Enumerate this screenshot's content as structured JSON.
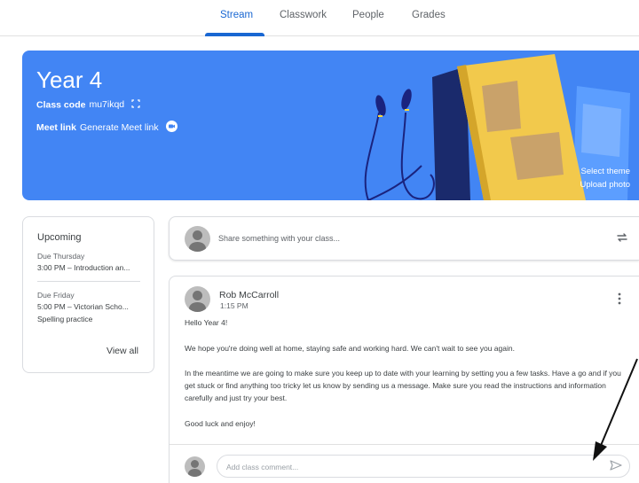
{
  "tabs": [
    {
      "label": "Stream"
    },
    {
      "label": "Classwork"
    },
    {
      "label": "People"
    },
    {
      "label": "Grades"
    }
  ],
  "banner": {
    "title": "Year 4",
    "class_code_label": "Class code",
    "class_code_value": "mu7ikqd",
    "meet_label": "Meet link",
    "meet_value": "Generate Meet link",
    "select_theme": "Select theme",
    "upload_photo": "Upload photo",
    "color": "#4285f4"
  },
  "upcoming": {
    "title": "Upcoming",
    "items": [
      {
        "due": "Due Thursday",
        "lines": [
          "3:00 PM – Introduction an..."
        ]
      },
      {
        "due": "Due Friday",
        "lines": [
          "5:00 PM – Victorian Scho...",
          "Spelling practice"
        ]
      }
    ],
    "view_all": "View all"
  },
  "share": {
    "placeholder": "Share something with your class..."
  },
  "post": {
    "author": "Rob McCarroll",
    "time": "1:15 PM",
    "paragraphs": [
      "Hello Year 4!",
      "We hope you're doing well at home, staying safe and working hard. We can't wait to see you again.",
      "In the meantime we are going to make sure you keep up to date with your learning by setting you a few tasks. Have a go and if you get stuck or find anything too tricky let us know by sending us a message. Make sure you read the instructions and information carefully and just try your best.",
      "Good luck and enjoy!"
    ],
    "comment_placeholder": "Add class comment..."
  },
  "accent": "#1967d2",
  "icons": {
    "code": "fullscreen-icon",
    "meet": "meet-icon",
    "repost": "repost-icon",
    "more": "more-vert-icon",
    "send": "send-icon"
  }
}
